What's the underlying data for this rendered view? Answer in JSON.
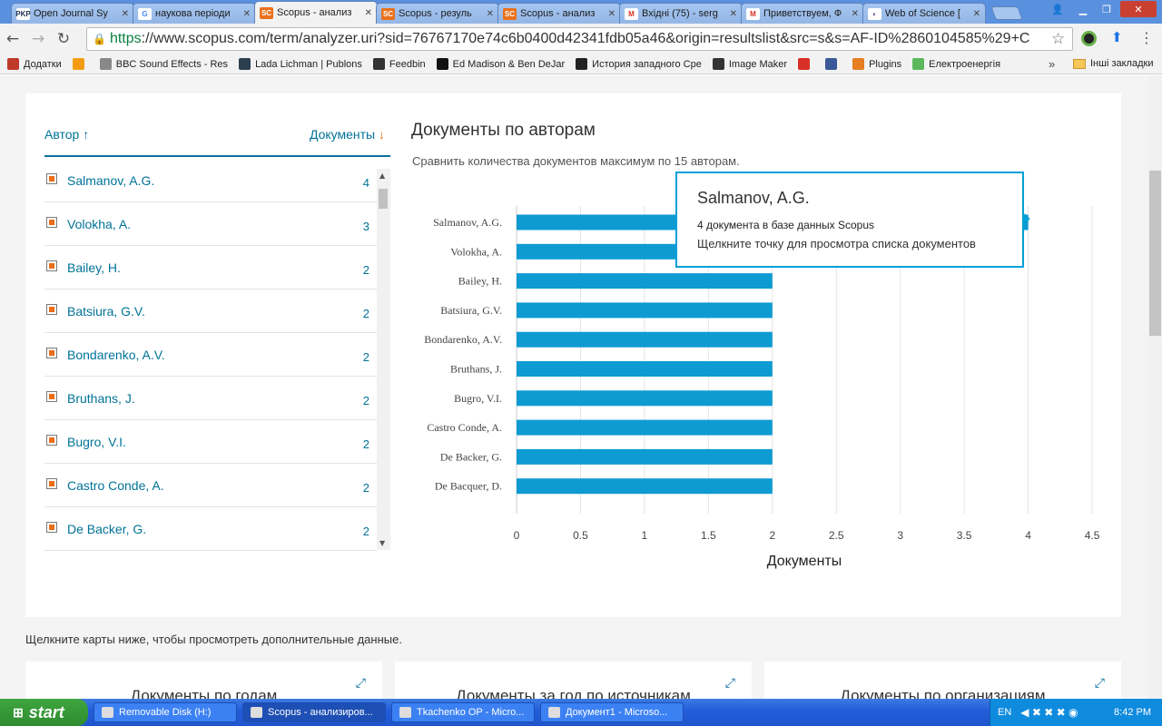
{
  "browser": {
    "tabs": [
      {
        "label": "Open Journal Sy",
        "fav": "PKP",
        "fav_bg": "#ffffff",
        "fav_fg": "#223355"
      },
      {
        "label": "наукова періоди",
        "fav": "G",
        "fav_bg": "#ffffff",
        "fav_fg": "#4285f4"
      },
      {
        "label": "Scopus - анализ",
        "fav": "SC",
        "fav_bg": "#e9711c",
        "fav_fg": "#ffffff",
        "active": true
      },
      {
        "label": "Scopus - резуль",
        "fav": "SC",
        "fav_bg": "#e9711c",
        "fav_fg": "#ffffff"
      },
      {
        "label": "Scopus - анализ",
        "fav": "SC",
        "fav_bg": "#e9711c",
        "fav_fg": "#ffffff"
      },
      {
        "label": "Вхідні (75) - serg",
        "fav": "M",
        "fav_bg": "#ffffff",
        "fav_fg": "#d93025"
      },
      {
        "label": "Приветствуем, Ф",
        "fav": "M",
        "fav_bg": "#ffffff",
        "fav_fg": "#d93025"
      },
      {
        "label": "Web of Science [",
        "fav": "◐",
        "fav_bg": "#ffffff",
        "fav_fg": "#6b4aa0"
      }
    ],
    "url_scheme": "https",
    "url_rest": "://www.scopus.com/term/analyzer.uri?sid=76767170e74c6b0400d42341fdb05a46&origin=resultslist&src=s&s=AF-ID%2860104585%29+C",
    "bookmarks": [
      {
        "label": "Додатки",
        "icon": "apps-icon",
        "bg": "#c0392b"
      },
      {
        "label": "",
        "icon": "circle-icon",
        "bg": "#f39c12"
      },
      {
        "label": "BBC Sound Effects - Res",
        "icon": "page-icon",
        "bg": "#888888"
      },
      {
        "label": "Lada Lichman | Publons",
        "icon": "publons-icon",
        "bg": "#2c3e50"
      },
      {
        "label": "Feedbin",
        "icon": "feedbin-icon",
        "bg": "#333333"
      },
      {
        "label": "Ed Madison & Ben DeJar",
        "icon": "medium-icon",
        "bg": "#111111"
      },
      {
        "label": "История западного Сре",
        "icon": "a-icon",
        "bg": "#222222"
      },
      {
        "label": "Image Maker",
        "icon": "imagemaker-icon",
        "bg": "#333333"
      },
      {
        "label": "",
        "icon": "gmail-icon",
        "bg": "#d93025"
      },
      {
        "label": "",
        "icon": "facebook-icon",
        "bg": "#3b5998"
      },
      {
        "label": "Plugins",
        "icon": "plugins-icon",
        "bg": "#e67e22"
      },
      {
        "label": "Електроенергія",
        "icon": "leaf-icon",
        "bg": "#5cb85c"
      }
    ],
    "bookmarks_other": "Інші закладки"
  },
  "analyzer": {
    "col_author": "Автор",
    "col_docs": "Документы",
    "authors": [
      {
        "name": "Salmanov, A.G.",
        "count": "4"
      },
      {
        "name": "Volokha, A.",
        "count": "3"
      },
      {
        "name": "Bailey, H.",
        "count": "2"
      },
      {
        "name": "Batsiura, G.V.",
        "count": "2"
      },
      {
        "name": "Bondarenko, A.V.",
        "count": "2"
      },
      {
        "name": "Bruthans, J.",
        "count": "2"
      },
      {
        "name": "Bugro, V.I.",
        "count": "2"
      },
      {
        "name": "Castro Conde, A.",
        "count": "2"
      },
      {
        "name": "De Backer, G.",
        "count": "2"
      }
    ],
    "chart_title": "Документы по авторам",
    "chart_subtitle": "Сравнить количества документов максимум по 15 авторам.",
    "tooltip": {
      "name": "Salmanov, A.G.",
      "line": "4 документа в базе данных Scopus",
      "hint": "Щелкните точку для просмотра списка документов"
    },
    "hint": "Щелкните карты ниже, чтобы просмотреть дополнительные данные.",
    "cards": [
      "Документы по годам",
      "Документы за год по источникам",
      "Документы по организациям"
    ]
  },
  "chart_data": {
    "type": "bar",
    "orientation": "horizontal",
    "categories": [
      "Salmanov, A.G.",
      "Volokha, A.",
      "Bailey, H.",
      "Batsiura, G.V.",
      "Bondarenko, A.V.",
      "Bruthans, J.",
      "Bugro, V.I.",
      "Castro Conde, A.",
      "De Backer, G.",
      "De Bacquer, D."
    ],
    "values": [
      4,
      3,
      2,
      2,
      2,
      2,
      2,
      2,
      2,
      2
    ],
    "xlabel": "Документы",
    "xlim": [
      0,
      4.5
    ],
    "xticks": [
      "0",
      "0.5",
      "1",
      "1.5",
      "2",
      "2.5",
      "3",
      "3.5",
      "4",
      "4.5"
    ],
    "grid": true,
    "bar_color": "#0d9bd2"
  },
  "taskbar": {
    "start": "start",
    "items": [
      {
        "label": "Removable Disk (H:)"
      },
      {
        "label": "Scopus - анализиров...",
        "active": true
      },
      {
        "label": "Tkachenko OP - Micro..."
      },
      {
        "label": "Документ1 - Microso..."
      }
    ],
    "lang": "EN",
    "clock": "8:42 PM"
  }
}
